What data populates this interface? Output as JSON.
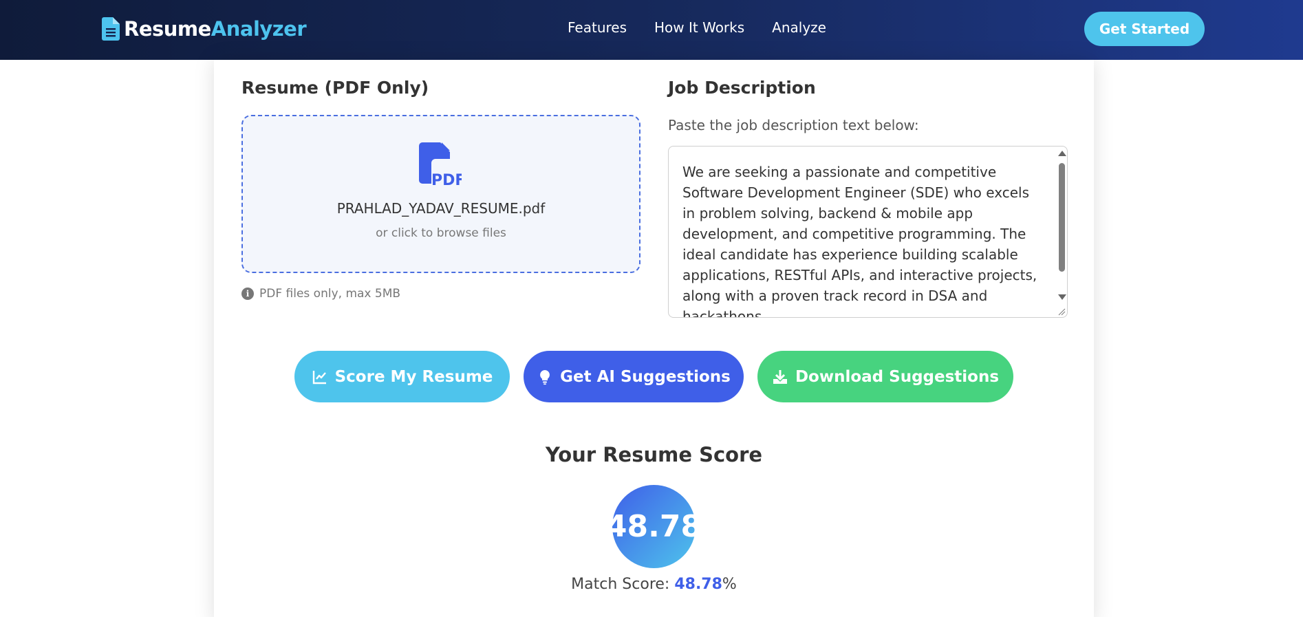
{
  "brand": {
    "part1": "Resume",
    "part2": "Analyzer",
    "icon": "file-icon"
  },
  "nav": {
    "links": [
      "Features",
      "How It Works",
      "Analyze"
    ],
    "cta_label": "Get Started"
  },
  "resume": {
    "title": "Resume (PDF Only)",
    "file_name": "PRAHLAD_YADAV_RESUME.pdf",
    "browse_text": "or click to browse files",
    "hint": "PDF files only, max 5MB",
    "icon": "pdf-file-icon"
  },
  "job": {
    "title": "Job Description",
    "label": "Paste the job description text below:",
    "text": "We are seeking a passionate and competitive Software Development Engineer (SDE) who excels in problem solving, backend & mobile app development, and competitive programming. The ideal candidate has experience building scalable applications, RESTful APIs, and interactive projects, along with a proven track record in DSA and hackathons."
  },
  "actions": {
    "score_label": "Score My Resume",
    "ai_label": "Get AI Suggestions",
    "download_label": "Download Suggestions"
  },
  "score": {
    "title": "Your Resume Score",
    "value": "48.78",
    "match_prefix": "Match Score: ",
    "match_value": "48.78",
    "match_suffix": "%"
  },
  "colors": {
    "accent_blue": "#3f5fe8",
    "accent_cyan": "#4ec4ec",
    "accent_green": "#47d37f",
    "nav_dark": "#0f1b3a"
  }
}
